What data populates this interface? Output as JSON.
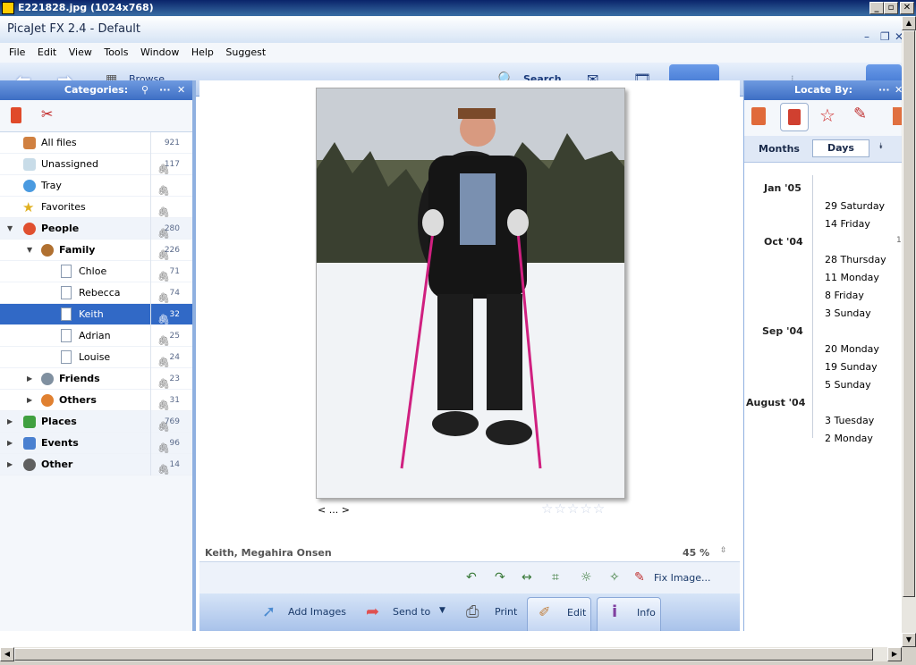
{
  "os_window": {
    "title": "E221828.jpg (1024x768)"
  },
  "app": {
    "title": "PicaJet FX 2.4 - Default"
  },
  "menu": [
    "File",
    "Edit",
    "View",
    "Tools",
    "Window",
    "Help",
    "Suggest"
  ],
  "toolbar": {
    "browse": "Browse",
    "search": "Search"
  },
  "left_panel": {
    "header": "Categories:",
    "items": [
      {
        "label": "All files",
        "count": "921",
        "bold": false
      },
      {
        "label": "Unassigned",
        "count": "117",
        "bold": false
      },
      {
        "label": "Tray",
        "count": "",
        "bold": false
      },
      {
        "label": "Favorites",
        "count": "",
        "bold": false
      },
      {
        "label": "People",
        "count": "280",
        "bold": true
      },
      {
        "label": "Family",
        "count": "226",
        "bold": true
      },
      {
        "label": "Chloe",
        "count": "71",
        "bold": false
      },
      {
        "label": "Rebecca",
        "count": "74",
        "bold": false
      },
      {
        "label": "Keith",
        "count": "32",
        "bold": false
      },
      {
        "label": "Adrian",
        "count": "25",
        "bold": false
      },
      {
        "label": "Louise",
        "count": "24",
        "bold": false
      },
      {
        "label": "Friends",
        "count": "23",
        "bold": true
      },
      {
        "label": "Others",
        "count": "31",
        "bold": true
      },
      {
        "label": "Places",
        "count": "769",
        "bold": true
      },
      {
        "label": "Events",
        "count": "96",
        "bold": true
      },
      {
        "label": "Other",
        "count": "14",
        "bold": true
      }
    ]
  },
  "viewer": {
    "nav": "< ... >",
    "caption": "Keith, Megahira Onsen",
    "zoom": "45 %",
    "fix_image": "Fix Image...",
    "rating_stars": 0
  },
  "bottom_bar": {
    "add_images": "Add Images",
    "send_to": "Send to",
    "print": "Print",
    "edit": "Edit",
    "info": "Info"
  },
  "right_panel": {
    "header": "Locate By:",
    "tab_months": "Months",
    "tab_days": "Days",
    "side_mark": "1",
    "groups": [
      {
        "month": "Jan '05",
        "days": [
          "29 Saturday",
          "14 Friday"
        ]
      },
      {
        "month": "Oct '04",
        "days": [
          "28 Thursday",
          "11 Monday",
          "8 Friday",
          "3 Sunday"
        ]
      },
      {
        "month": "Sep '04",
        "days": [
          "20 Monday",
          "19 Sunday",
          "5 Sunday"
        ]
      },
      {
        "month": "August '04",
        "days": [
          "3 Tuesday",
          "2 Monday"
        ]
      }
    ]
  }
}
